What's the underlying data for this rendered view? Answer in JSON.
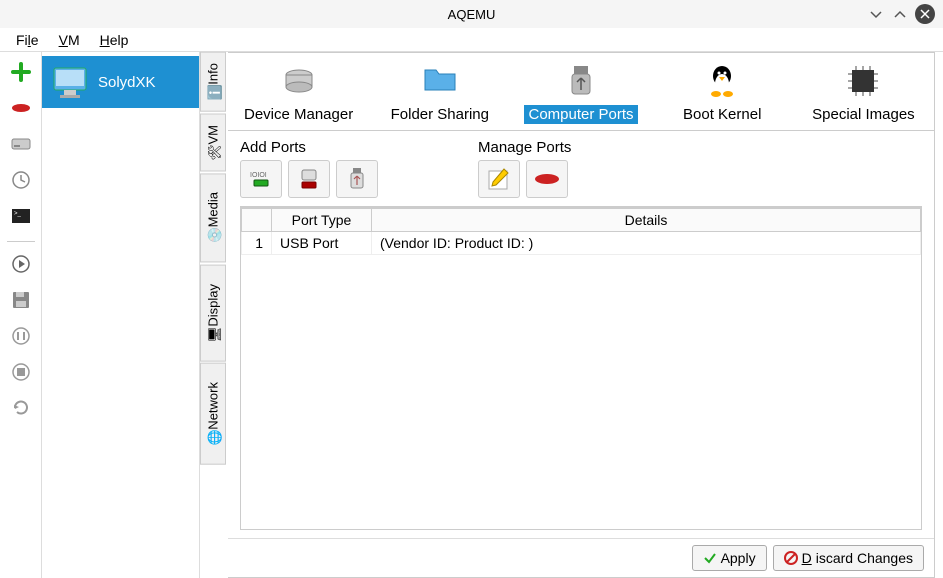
{
  "window": {
    "title": "AQEMU"
  },
  "menu": {
    "file": "File",
    "vm": "VM",
    "help": "Help"
  },
  "vmlist": {
    "items": [
      {
        "label": "SolydXK",
        "selected": true
      }
    ]
  },
  "sidetabs": [
    "Info",
    "VM",
    "Media",
    "Display",
    "Network"
  ],
  "toptabs": [
    {
      "label": "Device Manager"
    },
    {
      "label": "Folder Sharing"
    },
    {
      "label": "Computer Ports",
      "selected": true
    },
    {
      "label": "Boot Kernel"
    },
    {
      "label": "Special Images"
    }
  ],
  "sections": {
    "add": "Add Ports",
    "manage": "Manage Ports"
  },
  "table": {
    "headers": {
      "num": "",
      "type": "Port Type",
      "details": "Details"
    },
    "rows": [
      {
        "num": "1",
        "type": "USB Port",
        "details": "(Vendor ID:  Product ID: )"
      }
    ]
  },
  "footer": {
    "apply": "Apply",
    "discard": "Discard Changes"
  }
}
